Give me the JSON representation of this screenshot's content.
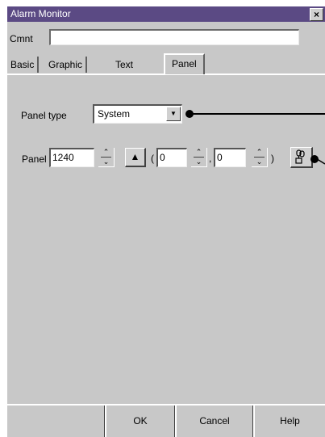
{
  "window": {
    "title": "Alarm Monitor",
    "close_label": "×"
  },
  "comment": {
    "label": "Cmnt",
    "value": ""
  },
  "tabs": [
    {
      "label": "Basic",
      "active": false
    },
    {
      "label": "Graphic",
      "active": false
    },
    {
      "label": "Text",
      "active": false
    },
    {
      "label": "Panel",
      "active": true
    }
  ],
  "panel_type": {
    "label": "Panel type",
    "selected": "System",
    "arrow_icon": "down-arrow-icon"
  },
  "panel": {
    "label": "Panel",
    "number": "1240",
    "eject_label": "▲",
    "open_paren": "(",
    "comma": ",",
    "close_paren": ")",
    "x_value": "0",
    "y_value": "0",
    "link_icon": "link-icon"
  },
  "buttons": {
    "ok": "OK",
    "cancel": "Cancel",
    "help": "Help"
  },
  "colors": {
    "titlebar": "#5b4a84",
    "dialog_bg": "#c8c8c8"
  }
}
